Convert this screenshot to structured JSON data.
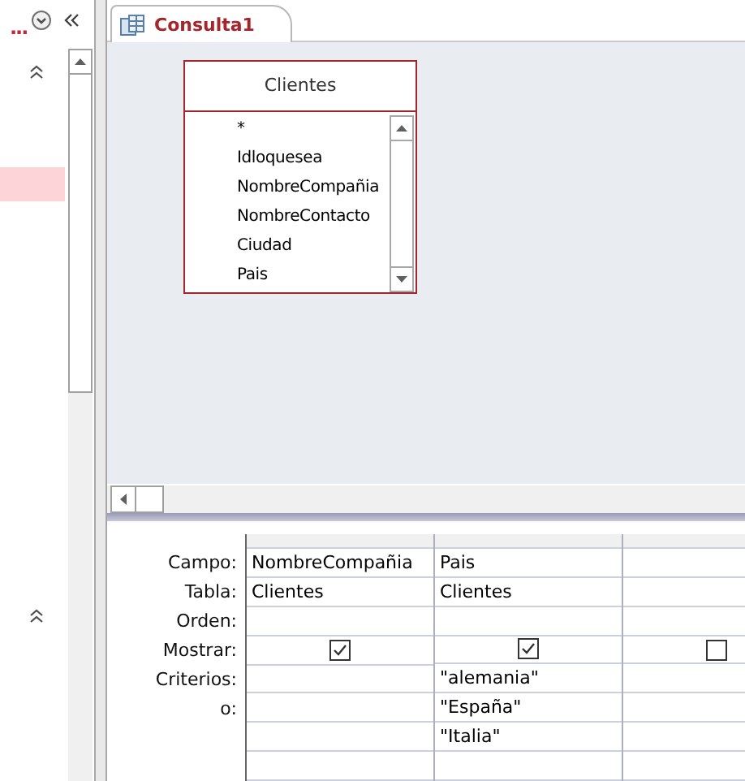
{
  "nav_pane": {
    "title": "..."
  },
  "tab": {
    "label": "Consulta1",
    "selected": true
  },
  "field_list": {
    "title": "Clientes",
    "fields": [
      "*",
      "Idloquesea",
      "NombreCompañia",
      "NombreContacto",
      "Ciudad",
      "Pais"
    ]
  },
  "grid": {
    "row_labels": [
      "Campo:",
      "Tabla:",
      "Orden:",
      "Mostrar:",
      "Criterios:",
      "o:"
    ],
    "columns": [
      {
        "field": "NombreCompañia",
        "table": "Clientes",
        "show": true
      },
      {
        "field": "Pais",
        "table": "Clientes",
        "show": true,
        "criteria": [
          "\"alemania\"",
          "\"España\"",
          "\"Italia\""
        ]
      },
      {
        "show": false
      }
    ]
  }
}
